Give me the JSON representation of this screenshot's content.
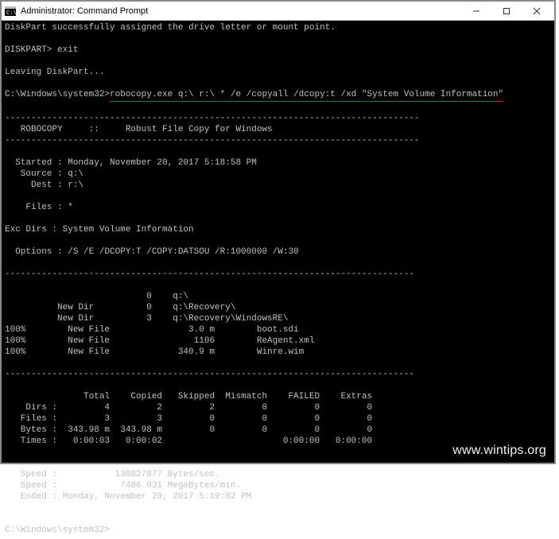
{
  "window": {
    "title": "Administrator: Command Prompt"
  },
  "terminal": {
    "line_msg": "DiskPart successfully assigned the drive letter or mount point.",
    "blank": "",
    "prompt1": "DISKPART> exit",
    "leaving": "Leaving DiskPart...",
    "prompt2_pre": "C:\\Windows\\system32>",
    "prompt2_cmd": "robocopy.exe q:\\ r:\\ * /e /copyall /dcopy:t /xd \"System Volume Information\"",
    "dash80": "-------------------------------------------------------------------------------",
    "robocopy_title": "   ROBOCOPY     ::     Robust File Copy for Windows",
    "started": "  Started : Monday, November 20, 2017 5:18:58 PM",
    "source": "   Source : q:\\",
    "dest": "     Dest : r:\\",
    "files": "    Files : *",
    "excdirs": "Exc Dirs : System Volume Information",
    "options": "  Options : /S /E /DCOPY:T /COPY:DATSOU /R:1000000 /W:30",
    "dash78": "------------------------------------------------------------------------------",
    "tree1": "                           0    q:\\",
    "tree2": "          New Dir          0    q:\\Recovery\\",
    "tree3": "          New Dir          3    q:\\Recovery\\WindowsRE\\",
    "tree4": "100%        New File               3.0 m        boot.sdi",
    "tree5": "100%        New File                1106        ReAgent.xml",
    "tree6": "100%        New File             340.9 m        Winre.wim",
    "stats_hdr": "               Total    Copied   Skipped  Mismatch    FAILED    Extras",
    "stats_dirs": "    Dirs :         4         2         2         0         0         0",
    "stats_files": "   Files :         3         3         0         0         0         0",
    "stats_bytes": "   Bytes :  343.98 m  343.98 m         0         0         0         0",
    "stats_times": "   Times :   0:00:03   0:00:02                       0:00:00   0:00:00",
    "speed1": "   Speed :           130827877 Bytes/sec.",
    "speed2": "   Speed :            7486.031 MegaBytes/min.",
    "ended": "   Ended : Monday, November 20, 2017 5:19:02 PM",
    "prompt3": "C:\\Windows\\system32>"
  },
  "watermark": "www.wintips.org"
}
